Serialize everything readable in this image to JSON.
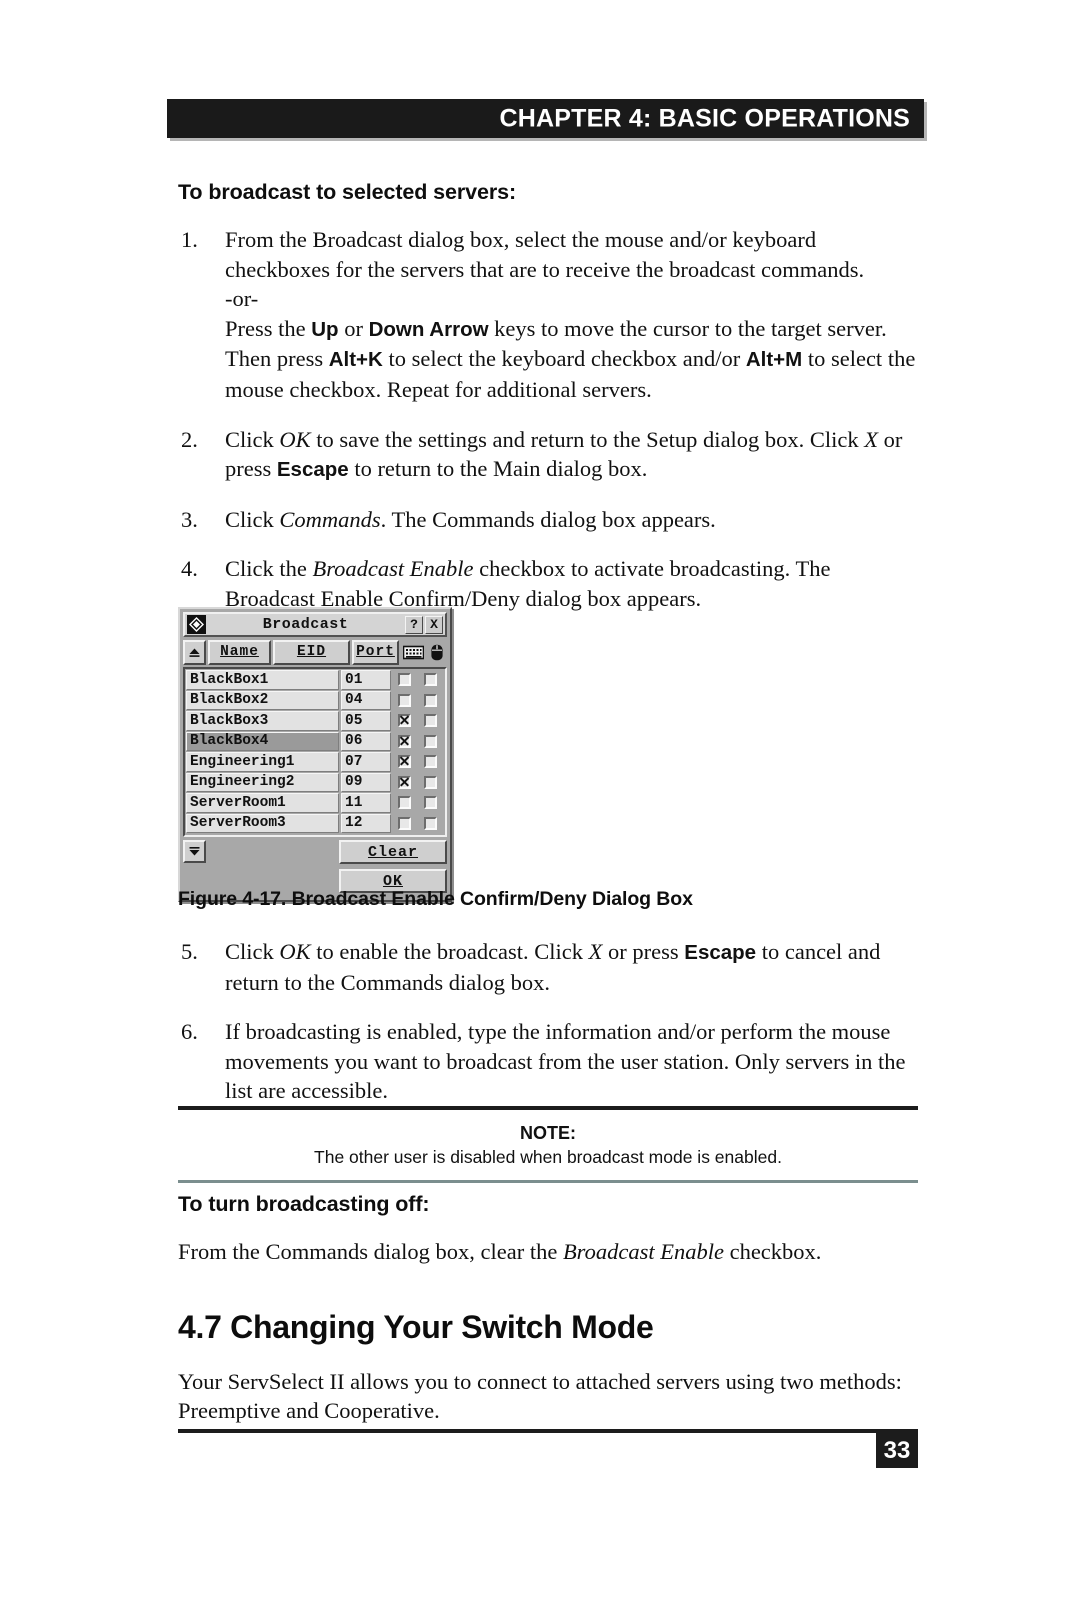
{
  "header": {
    "chapter_title": "CHAPTER 4: BASIC OPERATIONS"
  },
  "sections": {
    "broadcast_heading": "To broadcast to selected servers:",
    "turn_off_heading": "To turn broadcasting off:",
    "turn_off_body_pre": "From the Commands dialog box, clear the ",
    "turn_off_body_italic": "Broadcast Enable",
    "turn_off_body_post": " checkbox.",
    "switch_mode_heading": "4.7 Changing Your Switch Mode",
    "switch_mode_body": "Your ServSelect II allows you to connect to attached servers using two methods: Preemptive and Cooperative."
  },
  "steps": [
    {
      "num": "1.",
      "p1_a": "From the Broadcast dialog box, select the mouse and/or keyboard checkboxes for the servers that are to receive the broadcast commands.",
      "or": "-or-",
      "p2_a": "Press the ",
      "p2_b1": "Up",
      "p2_c": " or ",
      "p2_b2": "Down Arrow",
      "p2_d": " keys to move the cursor to the target server. Then press ",
      "p2_b3": "Alt+K",
      "p2_e": " to select the keyboard checkbox and/or ",
      "p2_b4": "Alt+M",
      "p2_f": " to select the mouse checkbox. Repeat for additional servers."
    },
    {
      "num": "2.",
      "a": "Click ",
      "i1": "OK",
      "b": " to save the settings and return to the Setup dialog box. Click ",
      "i2": "X",
      "c": " or press ",
      "s1": "Escape",
      "d": " to return to the Main dialog box."
    },
    {
      "num": "3.",
      "a": "Click ",
      "i1": "Commands",
      "b": ". The Commands dialog box appears."
    },
    {
      "num": "4.",
      "a": "Click the ",
      "i1": "Broadcast Enable",
      "b": " checkbox to activate broadcasting. The Broadcast Enable Confirm/Deny dialog box appears."
    },
    {
      "num": "5.",
      "a": "Click ",
      "i1": "OK",
      "b": " to enable the broadcast. Click ",
      "i2": "X",
      "c": " or press ",
      "s1": "Escape",
      "d": " to cancel and return to the Commands dialog box."
    },
    {
      "num": "6.",
      "a": "If broadcasting is enabled, type the information and/or perform the mouse movements you want to broadcast from the user station. Only servers in the list are accessible."
    }
  ],
  "dialog": {
    "title": "Broadcast",
    "icon": "app-diamond-icon",
    "help_button": "?",
    "close_button": "X",
    "scroll_up": "▲",
    "scroll_down": "▼",
    "columns": {
      "name": "Name",
      "eid": "EID",
      "port": "Port",
      "keyboard_icon": "keyboard-icon",
      "mouse_icon": "mouse-icon"
    },
    "rows": [
      {
        "name": "BlackBox1",
        "eid": "01",
        "keyboard": false,
        "mouse": false,
        "selected": false
      },
      {
        "name": "BlackBox2",
        "eid": "04",
        "keyboard": false,
        "mouse": false,
        "selected": false
      },
      {
        "name": "BlackBox3",
        "eid": "05",
        "keyboard": true,
        "mouse": false,
        "selected": false
      },
      {
        "name": "BlackBox4",
        "eid": "06",
        "keyboard": true,
        "mouse": false,
        "selected": true
      },
      {
        "name": "Engineering1",
        "eid": "07",
        "keyboard": true,
        "mouse": false,
        "selected": false
      },
      {
        "name": "Engineering2",
        "eid": "09",
        "keyboard": true,
        "mouse": false,
        "selected": false
      },
      {
        "name": "ServerRoom1",
        "eid": "11",
        "keyboard": false,
        "mouse": false,
        "selected": false
      },
      {
        "name": "ServerRoom3",
        "eid": "12",
        "keyboard": false,
        "mouse": false,
        "selected": false
      }
    ],
    "buttons": {
      "clear": "Clear",
      "ok": "OK"
    }
  },
  "figure": {
    "caption": "Figure 4-17. Broadcast Enable Confirm/Deny Dialog Box"
  },
  "note": {
    "label": "NOTE:",
    "text": "The other user is disabled when broadcast mode is enabled."
  },
  "footer": {
    "page_number": "33"
  },
  "colors": {
    "header_bar": "#1a1a1a",
    "note_rule_top": "#1c1c1c",
    "note_rule_bottom": "#7b8e8e",
    "dialog_face": "#a8a8a8",
    "dialog_button": "#cfcfcf",
    "row_selected": "#9a9a9a"
  }
}
